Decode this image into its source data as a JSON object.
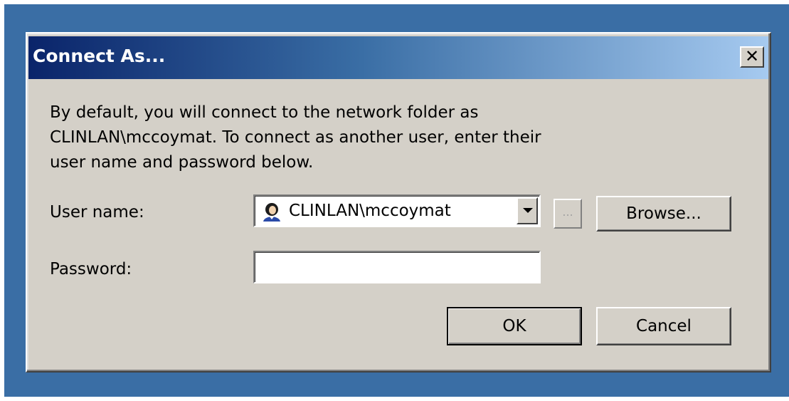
{
  "dialog": {
    "title": "Connect As...",
    "close_glyph": "✕",
    "message": "By default, you will connect to the network folder as\nCLINLAN\\mccoymat. To connect as another user, enter their\nuser name and password below."
  },
  "form": {
    "username_label": "User name:",
    "username_value": "CLINLAN\\mccoymat",
    "password_label": "Password:",
    "password_value": ""
  },
  "buttons": {
    "ellipsis": "...",
    "browse": "Browse...",
    "ok": "OK",
    "cancel": "Cancel"
  },
  "icons": {
    "user": "user-icon",
    "dropdown": "chevron-down-icon",
    "close": "close-icon"
  },
  "colors": {
    "desktop": "#3a6ea5",
    "titlebar_start": "#0a246a",
    "titlebar_end": "#a6caf0",
    "dialog_face": "#d4d0c8"
  }
}
